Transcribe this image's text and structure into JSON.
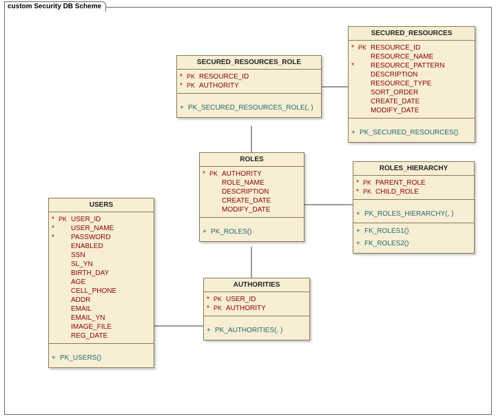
{
  "frame": {
    "title": "custom Security DB Scheme"
  },
  "entities": {
    "secured_resources_role": {
      "title": "SECURED_RESOURCES_ROLE",
      "attrs": [
        {
          "mark": "*",
          "key": "PK",
          "name": "RESOURCE_ID"
        },
        {
          "mark": "*",
          "key": "PK",
          "name": "AUTHORITY"
        }
      ],
      "ops": [
        {
          "vis": "+",
          "sig": "PK_SECURED_RESOURCES_ROLE(, )"
        }
      ]
    },
    "secured_resources": {
      "title": "SECURED_RESOURCES",
      "attrs": [
        {
          "mark": "*",
          "key": "PK",
          "name": "RESOURCE_ID"
        },
        {
          "mark": "",
          "key": "",
          "name": "RESOURCE_NAME"
        },
        {
          "mark": "*",
          "key": "",
          "name": "RESOURCE_PATTERN"
        },
        {
          "mark": "",
          "key": "",
          "name": "DESCRIPTION"
        },
        {
          "mark": "",
          "key": "",
          "name": "RESOURCE_TYPE"
        },
        {
          "mark": "",
          "key": "",
          "name": "SORT_ORDER"
        },
        {
          "mark": "",
          "key": "",
          "name": "CREATE_DATE"
        },
        {
          "mark": "",
          "key": "",
          "name": "MODIFY_DATE"
        }
      ],
      "ops": [
        {
          "vis": "+",
          "sig": "PK_SECURED_RESOURCES()"
        }
      ]
    },
    "roles": {
      "title": "ROLES",
      "attrs": [
        {
          "mark": "*",
          "key": "PK",
          "name": "AUTHORITY"
        },
        {
          "mark": "",
          "key": "",
          "name": "ROLE_NAME"
        },
        {
          "mark": "",
          "key": "",
          "name": "DESCRIPTION"
        },
        {
          "mark": "",
          "key": "",
          "name": "CREATE_DATE"
        },
        {
          "mark": "",
          "key": "",
          "name": "MODIFY_DATE"
        }
      ],
      "ops": [
        {
          "vis": "+",
          "sig": "PK_ROLES()"
        }
      ]
    },
    "roles_hierarchy": {
      "title": "ROLES_HIERARCHY",
      "attrs": [
        {
          "mark": "*",
          "key": "PK",
          "name": "PARENT_ROLE"
        },
        {
          "mark": "*",
          "key": "PK",
          "name": "CHILD_ROLE"
        }
      ],
      "ops": [
        {
          "vis": "+",
          "sig": "PK_ROLES_HIERARCHY(, )"
        },
        {
          "vis": "+",
          "sig": "FK_ROLES1()"
        },
        {
          "vis": "+",
          "sig": "FK_ROLES2()"
        }
      ]
    },
    "users": {
      "title": "USERS",
      "attrs": [
        {
          "mark": "*",
          "key": "PK",
          "name": "USER_ID"
        },
        {
          "mark": "*",
          "key": "",
          "name": "USER_NAME"
        },
        {
          "mark": "*",
          "key": "",
          "name": "PASSWORD"
        },
        {
          "mark": "",
          "key": "",
          "name": "ENABLED"
        },
        {
          "mark": "",
          "key": "",
          "name": "SSN"
        },
        {
          "mark": "",
          "key": "",
          "name": "SL_YN"
        },
        {
          "mark": "",
          "key": "",
          "name": "BIRTH_DAY"
        },
        {
          "mark": "",
          "key": "",
          "name": "AGE"
        },
        {
          "mark": "",
          "key": "",
          "name": "CELL_PHONE"
        },
        {
          "mark": "",
          "key": "",
          "name": "ADDR"
        },
        {
          "mark": "",
          "key": "",
          "name": "EMAIL"
        },
        {
          "mark": "",
          "key": "",
          "name": "EMAIL_YN"
        },
        {
          "mark": "",
          "key": "",
          "name": "IMAGE_FILE"
        },
        {
          "mark": "",
          "key": "",
          "name": "REG_DATE"
        }
      ],
      "ops": [
        {
          "vis": "+",
          "sig": "PK_USERS()"
        }
      ]
    },
    "authorities": {
      "title": "AUTHORITIES",
      "attrs": [
        {
          "mark": "*",
          "key": "PK",
          "name": "USER_ID"
        },
        {
          "mark": "*",
          "key": "PK",
          "name": "AUTHORITY"
        }
      ],
      "ops": [
        {
          "vis": "+",
          "sig": "PK_AUTHORITIES(, )"
        }
      ]
    }
  }
}
